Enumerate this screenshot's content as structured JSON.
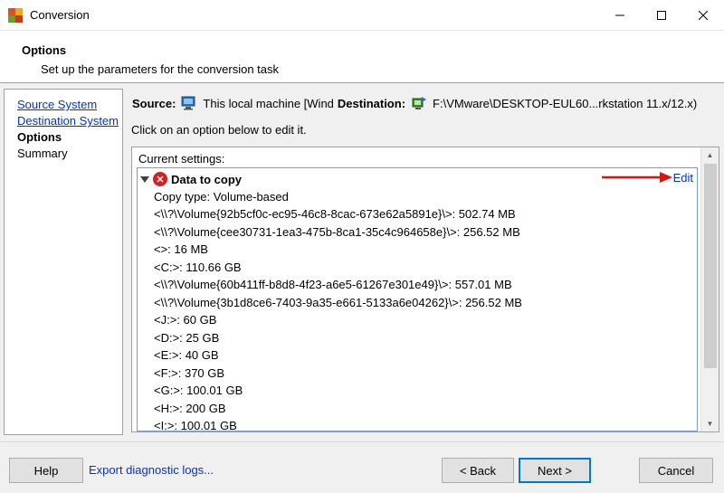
{
  "window": {
    "title": "Conversion",
    "controls": {
      "minimize": "—",
      "maximize": "☐",
      "close": "✕"
    }
  },
  "header": {
    "title": "Options",
    "subtitle": "Set up the parameters for the conversion task"
  },
  "nav": {
    "items": [
      {
        "label": "Source System",
        "state": "link"
      },
      {
        "label": "Destination System",
        "state": "link"
      },
      {
        "label": "Options",
        "state": "current"
      },
      {
        "label": "Summary",
        "state": "plain"
      }
    ]
  },
  "source": {
    "label": "Source:",
    "value": "This local machine [Wind",
    "icon": "computer-icon"
  },
  "destination": {
    "label": "Destination:",
    "value": "F:\\VMware\\DESKTOP-EUL60...rkstation 11.x/12.x)",
    "icon": "vm-transfer-icon"
  },
  "instruction": "Click on an option below to edit it.",
  "settings": {
    "caption": "Current settings:",
    "section": {
      "title": "Data to copy",
      "status_icon": "error-icon",
      "edit_label": "Edit",
      "lines": [
        "Copy type: Volume-based",
        "<\\\\?\\Volume{92b5cf0c-ec95-46c8-8cac-673e62a5891e}\\>: 502.74 MB",
        "<\\\\?\\Volume{cee30731-1ea3-475b-8ca1-35c4c964658e}\\>: 256.52 MB",
        "<>: 16 MB",
        "<C:>: 110.66 GB",
        "<\\\\?\\Volume{60b411ff-b8d8-4f23-a6e5-61267e301e49}\\>: 557.01 MB",
        "<\\\\?\\Volume{3b1d8ce6-7403-9a35-e661-5133a6e04262}\\>: 256.52 MB",
        "<J:>: 60 GB",
        "<D:>: 25 GB",
        "<E:>: 40 GB",
        "<F:>: 370 GB",
        "<G:>: 100.01 GB",
        "<H:>: 200 GB",
        "<I:>: 100.01 GB"
      ]
    }
  },
  "footer": {
    "help_label": "Help",
    "diagnostic_label": "Export diagnostic logs...",
    "back_label": "< Back",
    "next_label": "Next >",
    "cancel_label": "Cancel"
  },
  "colors": {
    "link": "#0033cc",
    "error": "#d42020",
    "arrow": "#e01010",
    "default_button_border": "#0078d7"
  }
}
